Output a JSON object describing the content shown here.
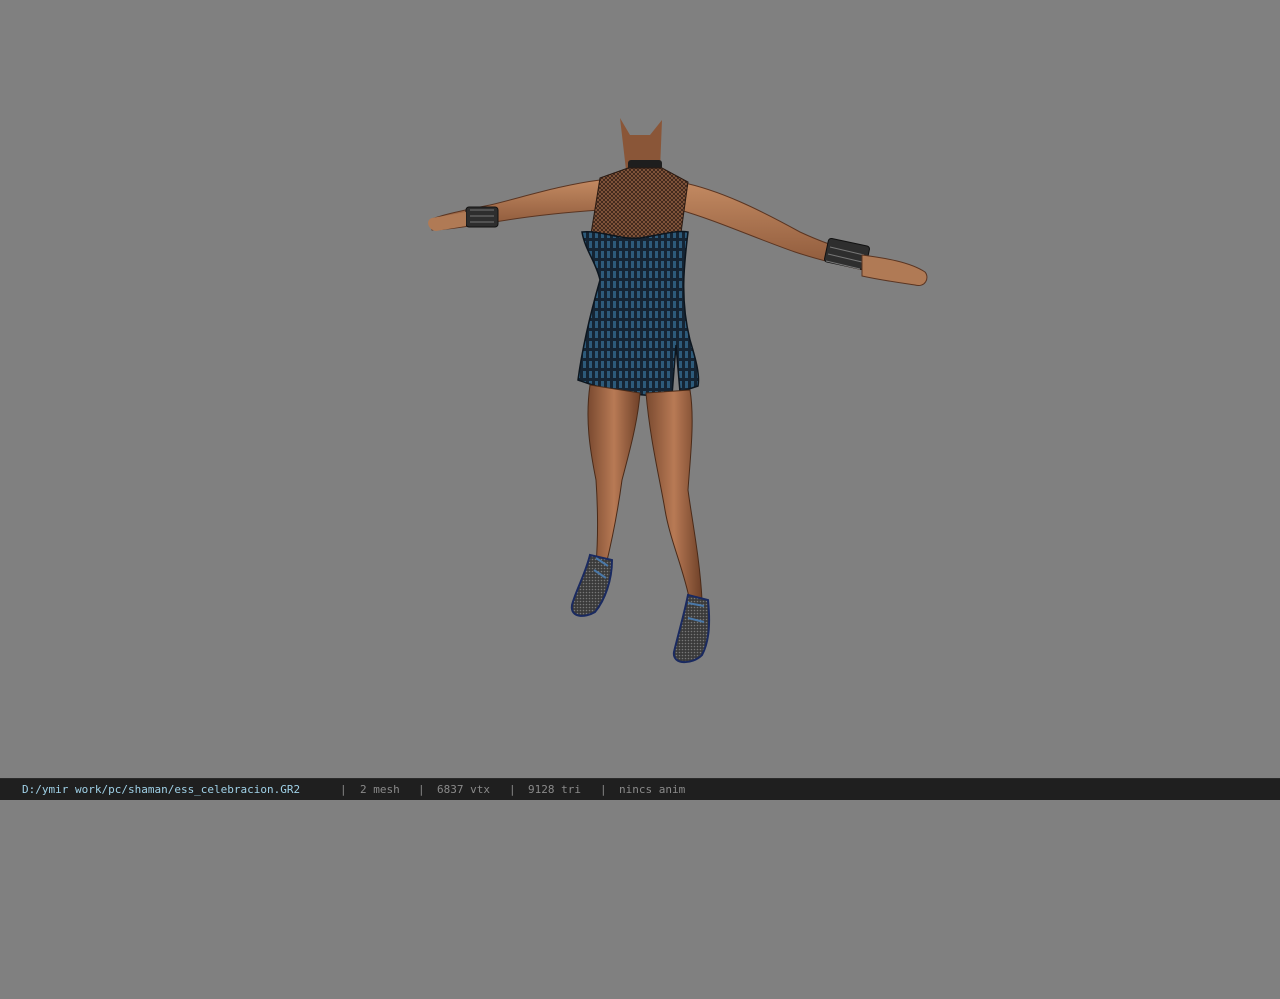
{
  "viewport": {
    "background": "#808080",
    "model_icon": "character-model-t-pose"
  },
  "statusbar": {
    "file_path": "D:/ymir work/pc/shaman/ess_celebracion.GR2",
    "separator": "|",
    "mesh": "2 mesh",
    "vertices": "6837 vtx",
    "triangles": "9128 tri",
    "anim": "nincs anim"
  }
}
